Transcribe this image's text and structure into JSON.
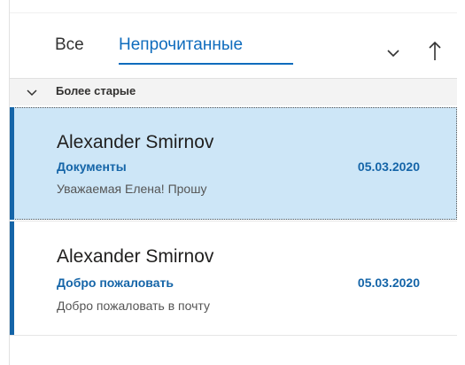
{
  "tabs": {
    "all_label": "Все",
    "unread_label": "Непрочитанные"
  },
  "icons": {
    "sort_options": "chevron-down-icon",
    "sort_direction": "arrow-up-icon",
    "group_collapse": "chevron-down-icon"
  },
  "group": {
    "label": "Более старые"
  },
  "colors": {
    "accent": "#0f6cbd",
    "unread_bar": "#1565a8",
    "selected_bg": "#cde6f7",
    "group_bg": "#f3f3f3"
  },
  "messages": [
    {
      "sender": "Alexander Smirnov",
      "subject": "Документы",
      "date": "05.03.2020",
      "preview": "Уважаемая Елена!  Прошу",
      "selected": true,
      "unread": true
    },
    {
      "sender": "Alexander Smirnov",
      "subject": "Добро пожаловать",
      "date": "05.03.2020",
      "preview": "Добро пожаловать в почту",
      "selected": false,
      "unread": true
    }
  ]
}
